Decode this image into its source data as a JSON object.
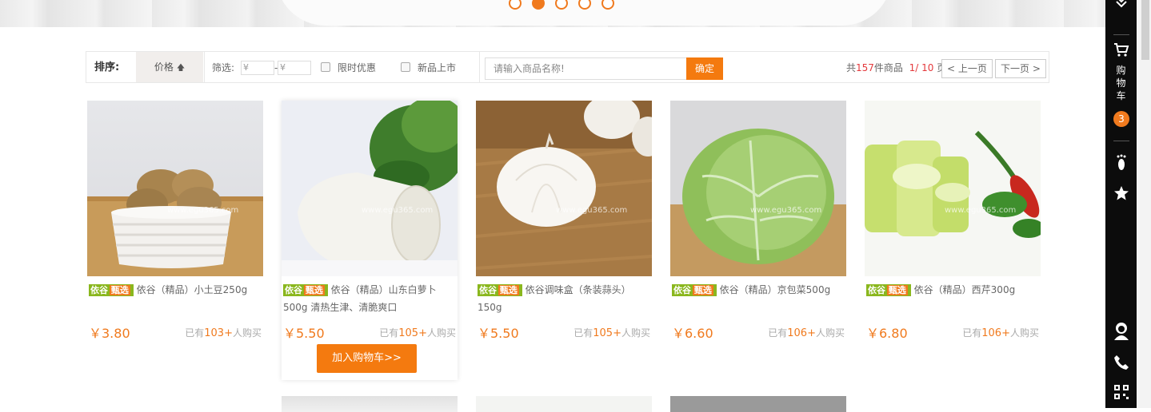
{
  "sort": {
    "label": "排序:",
    "price_label": "价格",
    "price_arrow": "🡅"
  },
  "filter": {
    "label": "筛选:",
    "price_min_placeholder": "¥",
    "price_max_placeholder": "¥",
    "dash": "-",
    "limited_offer": "限时优惠",
    "new_arrival": "新品上市"
  },
  "search": {
    "placeholder": "请输入商品名称!",
    "button": "确定"
  },
  "pagination": {
    "prefix": "共",
    "total": "157",
    "total_suffix": "件商品",
    "current": "1",
    "slash": "/",
    "pages": "10",
    "page_suffix": "页",
    "prev": "< 上一页",
    "next": "下一页 >"
  },
  "brand_tag": {
    "a": "依谷",
    "b": "甄选"
  },
  "watermark": "www.egu365.com",
  "products": [
    {
      "name": "依谷（精品）小土豆250g",
      "price": "￥3.80",
      "sold_prefix": "已有",
      "sold": "103+",
      "sold_suffix": "人购买"
    },
    {
      "name": "依谷（精品）山东白萝卜500g  清热生津、清脆爽口",
      "price": "￥5.50",
      "sold_prefix": "已有",
      "sold": "105+",
      "sold_suffix": "人购买",
      "add_to_cart": "加入购物车>>"
    },
    {
      "name": "依谷调味盒（条装蒜头）150g",
      "price": "￥5.50",
      "sold_prefix": "已有",
      "sold": "105+",
      "sold_suffix": "人购买"
    },
    {
      "name": "依谷（精品）京包菜500g",
      "price": "￥6.60",
      "sold_prefix": "已有",
      "sold": "106+",
      "sold_suffix": "人购买"
    },
    {
      "name": "依谷（精品）西芹300g",
      "price": "￥6.80",
      "sold_prefix": "已有",
      "sold": "106+",
      "sold_suffix": "人购买"
    }
  ],
  "sidebar": {
    "cart_label": "购物车",
    "cart_count": "3"
  },
  "colors": {
    "accent": "#f47a0f",
    "tag_green": "#8ab71e",
    "sidebar": "#0c0c0c"
  }
}
